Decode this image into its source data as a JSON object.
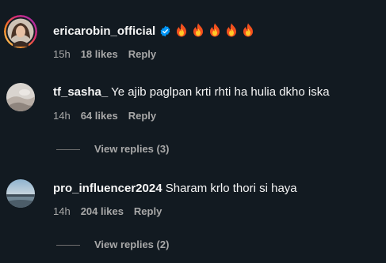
{
  "comments": [
    {
      "username": "ericarobin_official",
      "verified": true,
      "text": "",
      "emoji_count": 5,
      "time": "15h",
      "likes": "18 likes",
      "reply": "Reply"
    },
    {
      "username": "tf_sasha_",
      "verified": false,
      "text": "Ye ajib paglpan krti rhti ha hulia dkho iska",
      "time": "14h",
      "likes": "64 likes",
      "reply": "Reply",
      "view_replies": "View replies (3)"
    },
    {
      "username": "pro_influencer2024",
      "verified": false,
      "text": "Sharam krlo thori si haya",
      "time": "14h",
      "likes": "204 likes",
      "reply": "Reply",
      "view_replies": "View replies (2)"
    }
  ],
  "colors": {
    "background": "#121a21",
    "text_primary": "#f5f5f5",
    "text_secondary": "#a8a8a8",
    "verified_blue": "#0095f6",
    "story_ring": "#d6249f"
  },
  "icons": {
    "verified": "verified-badge-icon",
    "emoji": "fire-emoji-icon"
  }
}
